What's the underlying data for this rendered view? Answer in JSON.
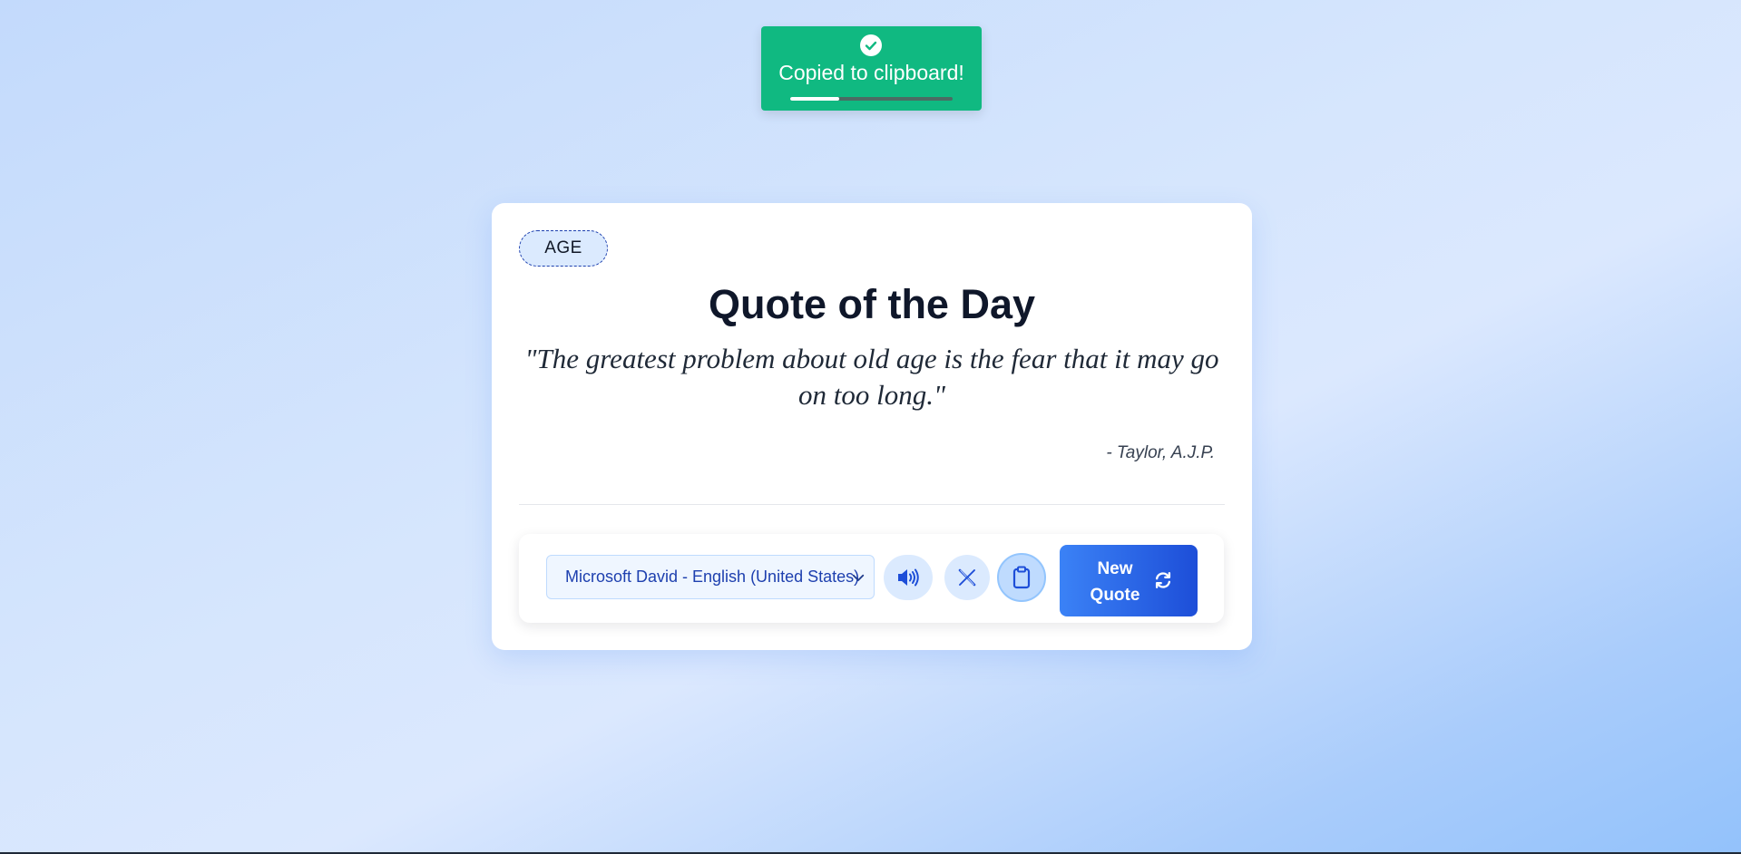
{
  "toast": {
    "message": "Copied to clipboard!",
    "icon": "check-circle-icon",
    "progress": 0.3,
    "color": "#10b981"
  },
  "card": {
    "tag": "AGE",
    "title": "Quote of the Day",
    "quote": "\"The greatest problem about old age is the fear that it may go on too long.\"",
    "author": "- Taylor, A.J.P."
  },
  "controls": {
    "voice_select": {
      "value": "Microsoft David - English (United States)",
      "icon": "chevron-down-icon"
    },
    "speak_button": {
      "icon": "speaker-icon"
    },
    "share_button": {
      "icon": "x-logo-icon"
    },
    "copy_button": {
      "icon": "clipboard-icon"
    },
    "new_quote_button": {
      "label": "New Quote",
      "icon": "refresh-icon"
    }
  },
  "colors": {
    "accent": "#3b82f6",
    "accent_dark": "#1d4ed8",
    "success": "#10b981"
  }
}
